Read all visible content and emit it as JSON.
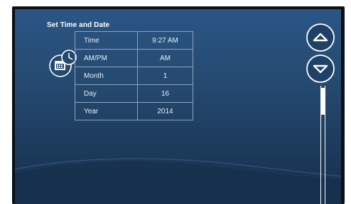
{
  "screen": {
    "title": "Set Time and Date",
    "rows": [
      {
        "label": "Time",
        "value": "9:27 AM"
      },
      {
        "label": "AM/PM",
        "value": "AM"
      },
      {
        "label": "Month",
        "value": "1"
      },
      {
        "label": "Day",
        "value": "16"
      },
      {
        "label": "Year",
        "value": "2014"
      }
    ]
  },
  "icons": {
    "settings": "calendar-clock-icon",
    "scroll_up": "chevron-up-icon",
    "scroll_down": "chevron-down-icon"
  },
  "colors": {
    "background_top": "#2b5684",
    "background_bottom": "#172f4c",
    "text": "#ffffff",
    "grid_line": "#8fa4bd"
  }
}
